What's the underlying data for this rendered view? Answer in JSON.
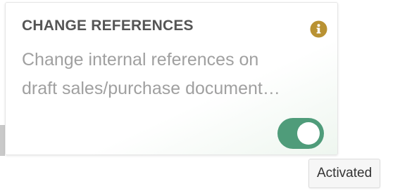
{
  "card": {
    "title": "CHANGE REFERENCES",
    "description_line1": "Change internal references on",
    "description_line2": "draft sales/purchase document…",
    "info_icon": "info-icon",
    "toggle_state": "on"
  },
  "tooltip": {
    "text": "Activated"
  },
  "colors": {
    "toggle_on": "#4f9c7a",
    "info_icon": "#b99233",
    "title": "#555555",
    "description": "#a0a0a0"
  }
}
